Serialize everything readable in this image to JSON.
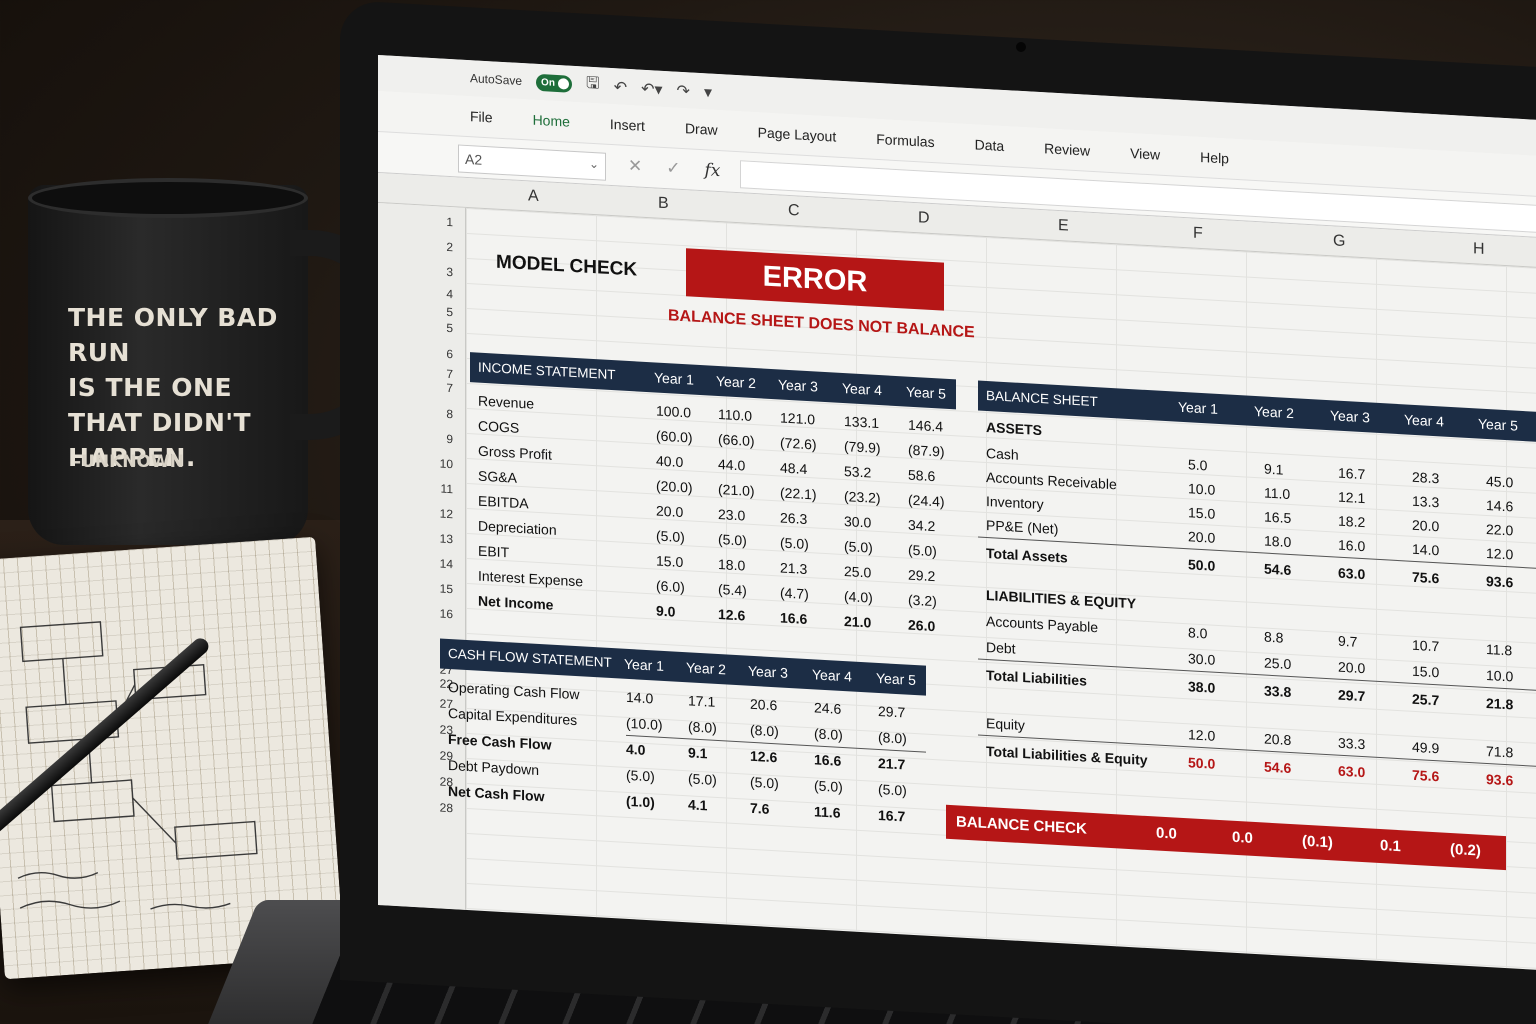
{
  "mug": {
    "lines": [
      "THE ONLY BAD RUN",
      "IS THE ONE",
      "THAT DIDN'T",
      "HAPPEN."
    ],
    "author": "-UNKNOWN"
  },
  "qat": {
    "autosave_label": "AutoSave",
    "toggle_label": "On"
  },
  "ribbon_tabs": [
    "File",
    "Home",
    "Insert",
    "Draw",
    "Page Layout",
    "Formulas",
    "Data",
    "Review",
    "View",
    "Help"
  ],
  "formula_bar": {
    "name_box": "A2",
    "fx_label": "fx",
    "formula": ""
  },
  "column_headers": [
    "A",
    "B",
    "C",
    "D",
    "E",
    "F",
    "G",
    "H"
  ],
  "row_headers": [
    "1",
    "2",
    "3",
    "4",
    "5",
    "5",
    "6",
    "7",
    "7",
    "8",
    "9",
    "10",
    "11",
    "12",
    "13",
    "14",
    "15",
    "16",
    "18",
    "27",
    "22",
    "27",
    "23",
    "29",
    "28",
    "28"
  ],
  "model_check": {
    "title": "MODEL CHECK",
    "error": "ERROR",
    "message": "BALANCE SHEET DOES NOT BALANCE"
  },
  "years": [
    "Year 1",
    "Year 2",
    "Year 3",
    "Year 4",
    "Year 5"
  ],
  "income_statement": {
    "title": "INCOME STATEMENT",
    "rows": [
      {
        "label": "Revenue",
        "values": [
          "100.0",
          "110.0",
          "121.0",
          "133.1",
          "146.4"
        ]
      },
      {
        "label": "COGS",
        "values": [
          "(60.0)",
          "(66.0)",
          "(72.6)",
          "(79.9)",
          "(87.9)"
        ]
      },
      {
        "label": "Gross Profit",
        "values": [
          "40.0",
          "44.0",
          "48.4",
          "53.2",
          "58.6"
        ]
      },
      {
        "label": "SG&A",
        "values": [
          "(20.0)",
          "(21.0)",
          "(22.1)",
          "(23.2)",
          "(24.4)"
        ]
      },
      {
        "label": "EBITDA",
        "values": [
          "20.0",
          "23.0",
          "26.3",
          "30.0",
          "34.2"
        ]
      },
      {
        "label": "Depreciation",
        "values": [
          "(5.0)",
          "(5.0)",
          "(5.0)",
          "(5.0)",
          "(5.0)"
        ]
      },
      {
        "label": "EBIT",
        "values": [
          "15.0",
          "18.0",
          "21.3",
          "25.0",
          "29.2"
        ]
      },
      {
        "label": "Interest Expense",
        "values": [
          "(6.0)",
          "(5.4)",
          "(4.7)",
          "(4.0)",
          "(3.2)"
        ]
      },
      {
        "label": "Net Income",
        "values": [
          "9.0",
          "12.6",
          "16.6",
          "21.0",
          "26.0"
        ]
      }
    ]
  },
  "cash_flow": {
    "title": "CASH FLOW STATEMENT",
    "rows": [
      {
        "label": "Operating Cash Flow",
        "values": [
          "14.0",
          "17.1",
          "20.6",
          "24.6",
          "29.7"
        ]
      },
      {
        "label": "Capital Expenditures",
        "values": [
          "(10.0)",
          "(8.0)",
          "(8.0)",
          "(8.0)",
          "(8.0)"
        ]
      },
      {
        "label": "Free Cash Flow",
        "values": [
          "4.0",
          "9.1",
          "12.6",
          "16.6",
          "21.7"
        ]
      },
      {
        "label": "Debt Paydown",
        "values": [
          "(5.0)",
          "(5.0)",
          "(5.0)",
          "(5.0)",
          "(5.0)"
        ]
      },
      {
        "label": "Net Cash Flow",
        "values": [
          "(1.0)",
          "4.1",
          "7.6",
          "11.6",
          "16.7"
        ]
      }
    ]
  },
  "balance_sheet": {
    "title": "BALANCE SHEET",
    "assets_header": "ASSETS",
    "assets": [
      {
        "label": "Cash",
        "values": [
          "5.0",
          "9.1",
          "16.7",
          "28.3",
          "45.0"
        ]
      },
      {
        "label": "Accounts Receivable",
        "values": [
          "10.0",
          "11.0",
          "12.1",
          "13.3",
          "14.6"
        ]
      },
      {
        "label": "Inventory",
        "values": [
          "15.0",
          "16.5",
          "18.2",
          "20.0",
          "22.0"
        ]
      },
      {
        "label": "PP&E (Net)",
        "values": [
          "20.0",
          "18.0",
          "16.0",
          "14.0",
          "12.0"
        ]
      }
    ],
    "total_assets": {
      "label": "Total Assets",
      "values": [
        "50.0",
        "54.6",
        "63.0",
        "75.6",
        "93.6"
      ]
    },
    "liab_header": "LIABILITIES & EQUITY",
    "liabilities": [
      {
        "label": "Accounts Payable",
        "values": [
          "8.0",
          "8.8",
          "9.7",
          "10.7",
          "11.8"
        ]
      },
      {
        "label": "Debt",
        "values": [
          "30.0",
          "25.0",
          "20.0",
          "15.0",
          "10.0"
        ]
      }
    ],
    "total_liabilities": {
      "label": "Total Liabilities",
      "values": [
        "38.0",
        "33.8",
        "29.7",
        "25.7",
        "21.8"
      ]
    },
    "equity": {
      "label": "Equity",
      "values": [
        "12.0",
        "20.8",
        "33.3",
        "49.9",
        "71.8"
      ]
    },
    "total_le": {
      "label": "Total Liabilities & Equity",
      "values": [
        "50.0",
        "54.6",
        "63.0",
        "75.6",
        "93.6"
      ]
    },
    "balance_check": {
      "label": "BALANCE CHECK",
      "values": [
        "0.0",
        "0.0",
        "(0.1)",
        "0.1",
        "(0.2)"
      ]
    }
  },
  "colors": {
    "error_red": "#b51616",
    "header_navy": "#1c2d45",
    "excel_green": "#1e6e3a"
  }
}
